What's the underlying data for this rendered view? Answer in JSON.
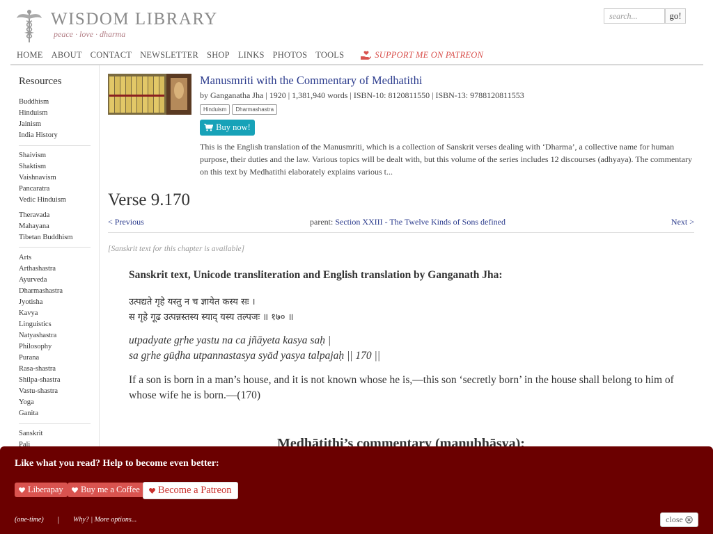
{
  "header": {
    "site_title": "WISDOM LIBRARY",
    "tagline": "peace · love · dharma",
    "logo_icon": "caduceus-icon",
    "search_placeholder": "search...",
    "search_button": "go!"
  },
  "nav": {
    "items": [
      "HOME",
      "ABOUT",
      "CONTACT",
      "NEWSLETTER",
      "SHOP",
      "LINKS",
      "PHOTOS",
      "TOOLS"
    ],
    "patreon_label": "SUPPORT ME ON PATREON",
    "patreon_icon": "heart-hand-icon"
  },
  "sidebar": {
    "title": "Resources",
    "groups": [
      [
        "Buddhism",
        "Hinduism",
        "Jainism",
        "India History"
      ],
      [
        "Shaivism",
        "Shaktism",
        "Vaishnavism",
        "Pancaratra",
        "Vedic Hinduism"
      ],
      [
        "Theravada",
        "Mahayana",
        "Tibetan Buddhism"
      ],
      [
        "Arts",
        "Arthashastra",
        "Ayurveda",
        "Dharmashastra",
        "Jyotisha",
        "Kavya",
        "Linguistics",
        "Natyashastra",
        "Philosophy",
        "Purana",
        "Rasa-shastra",
        "Shilpa-shastra",
        "Vastu-shastra",
        "Yoga",
        "Ganita"
      ],
      [
        "Sanskrit",
        "Pali"
      ]
    ]
  },
  "book": {
    "title": "Manusmriti with the Commentary of Medhatithi",
    "meta": "by Ganganatha Jha | 1920 | 1,381,940 words | ISBN-10: 8120811550 | ISBN-13: 9788120811553",
    "tags": [
      "Hinduism",
      "Dharmashastra"
    ],
    "buy_label": "Buy now!",
    "description": "This is the English translation of the Manusmriti, which is a collection of Sanskrit verses dealing with ‘Dharma’, a collective name for human purpose, their duties and the law. Various topics will be dealt with, but this volume of the series includes 12 discourses (adhyaya). The commentary on this text by Medhatithi elaborately explains various t..."
  },
  "verse": {
    "title": "Verse 9.170",
    "prev": "< Previous",
    "parent_prefix": "parent: ",
    "parent_link": "Section XXIII - The Twelve Kinds of Sons defined",
    "next": "Next >",
    "sanskrit_note": "[Sanskrit text for this chapter is available]",
    "section_heading": "Sanskrit text, Unicode transliteration and English translation by Ganganath Jha:",
    "devanagari": [
      "उत्पद्यते गृहे यस्तु न च ज्ञायेत कस्य सः ।",
      "स गृहे गूढ उत्पन्नस्तस्य स्याद् यस्य तल्पजः ॥ १७० ॥"
    ],
    "transliteration": [
      "utpadyate gṛhe yastu na ca jñāyeta kasya saḥ |",
      "sa gṛhe gūḍha utpannastasya syād yasya talpajaḥ || 170 ||"
    ],
    "translation": "If a son is born in a man’s house, and it is not known whose he is,—this son ‘secretly born’ in the house shall belong to him of whose wife he is born.—(170)",
    "commentary_heading": "Medhātithi’s commentary (manubhāṣya):"
  },
  "donate": {
    "heading": "Like what you read? Help to become even better:",
    "liberapay": "Liberapay",
    "coffee": "Buy me a Coffee",
    "patreon": "Become a Patreon",
    "one_time": "(one-time)",
    "pipe": "|",
    "more": "Why? | More options...",
    "close": "close",
    "colors": {
      "bar": "#6b0000",
      "button": "#d9534f"
    }
  },
  "colors": {
    "link": "#2a3a8c",
    "buy_button": "#17a2b8",
    "patreon_accent": "#d9534f"
  }
}
